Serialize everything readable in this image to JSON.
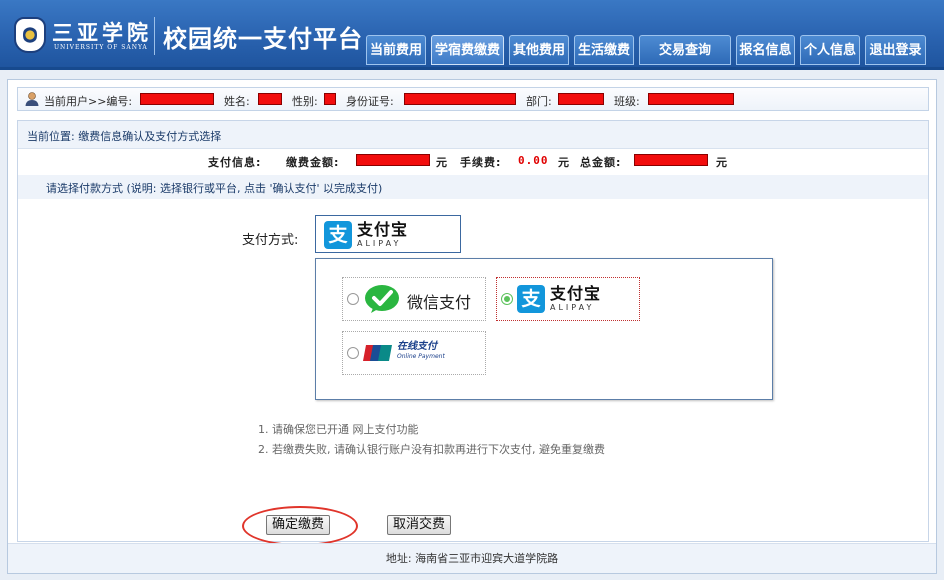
{
  "brand": {
    "logo_cn": "三亚学院",
    "logo_en": "UNIVERSITY OF SANYA",
    "site_title": "校园统一支付平台"
  },
  "nav": {
    "items": [
      {
        "label": "当前费用"
      },
      {
        "label": "学宿费缴费"
      },
      {
        "label": "其他费用"
      },
      {
        "label": "生活缴费"
      },
      {
        "label": "交易查询"
      },
      {
        "label": "报名信息"
      },
      {
        "label": "个人信息"
      },
      {
        "label": "退出登录"
      }
    ],
    "active_index": 1
  },
  "userbar": {
    "current_user": "当前用户>>编号:",
    "name_label": "姓名:",
    "gender_label": "性别:",
    "id_label": "身份证号:",
    "dept_label": "部门:",
    "class_label": "班级:"
  },
  "breadcrumb": "当前位置: 缴费信息确认及支付方式选择",
  "payinfo": {
    "label": "支付信息:",
    "amount_label": "缴费金额:",
    "unit1": "元",
    "fee_label": "手续费:",
    "fee_value": "0.00",
    "unit2": "元",
    "total_label": "总金额:",
    "unit3": "元"
  },
  "hint": "请选择付款方式 (说明: 选择银行或平台, 点击 '确认支付' 以完成支付)",
  "payment": {
    "method_label": "支付方式:",
    "selected": "alipay",
    "alipay_cn": "支付宝",
    "alipay_en": "ALIPAY",
    "wechat_label": "微信支付",
    "unionpay_cn": "在线支付",
    "unionpay_en": "Online Payment"
  },
  "notes": [
    "1. 请确保您已开通 网上支付功能",
    "2. 若缴费失败, 请确认银行账户没有扣款再进行下次支付, 避免重复缴费"
  ],
  "buttons": {
    "confirm": "确定缴费",
    "cancel": "取消交费"
  },
  "footer": "地址: 海南省三亚市迎宾大道学院路",
  "colors": {
    "header_blue": "#2a63b0",
    "redaction": "#f20d0d",
    "alipay_blue": "#1296db",
    "wechat_green": "#2ab640",
    "fee_red": "#e00000",
    "annotation_circle": "#e0352b"
  }
}
